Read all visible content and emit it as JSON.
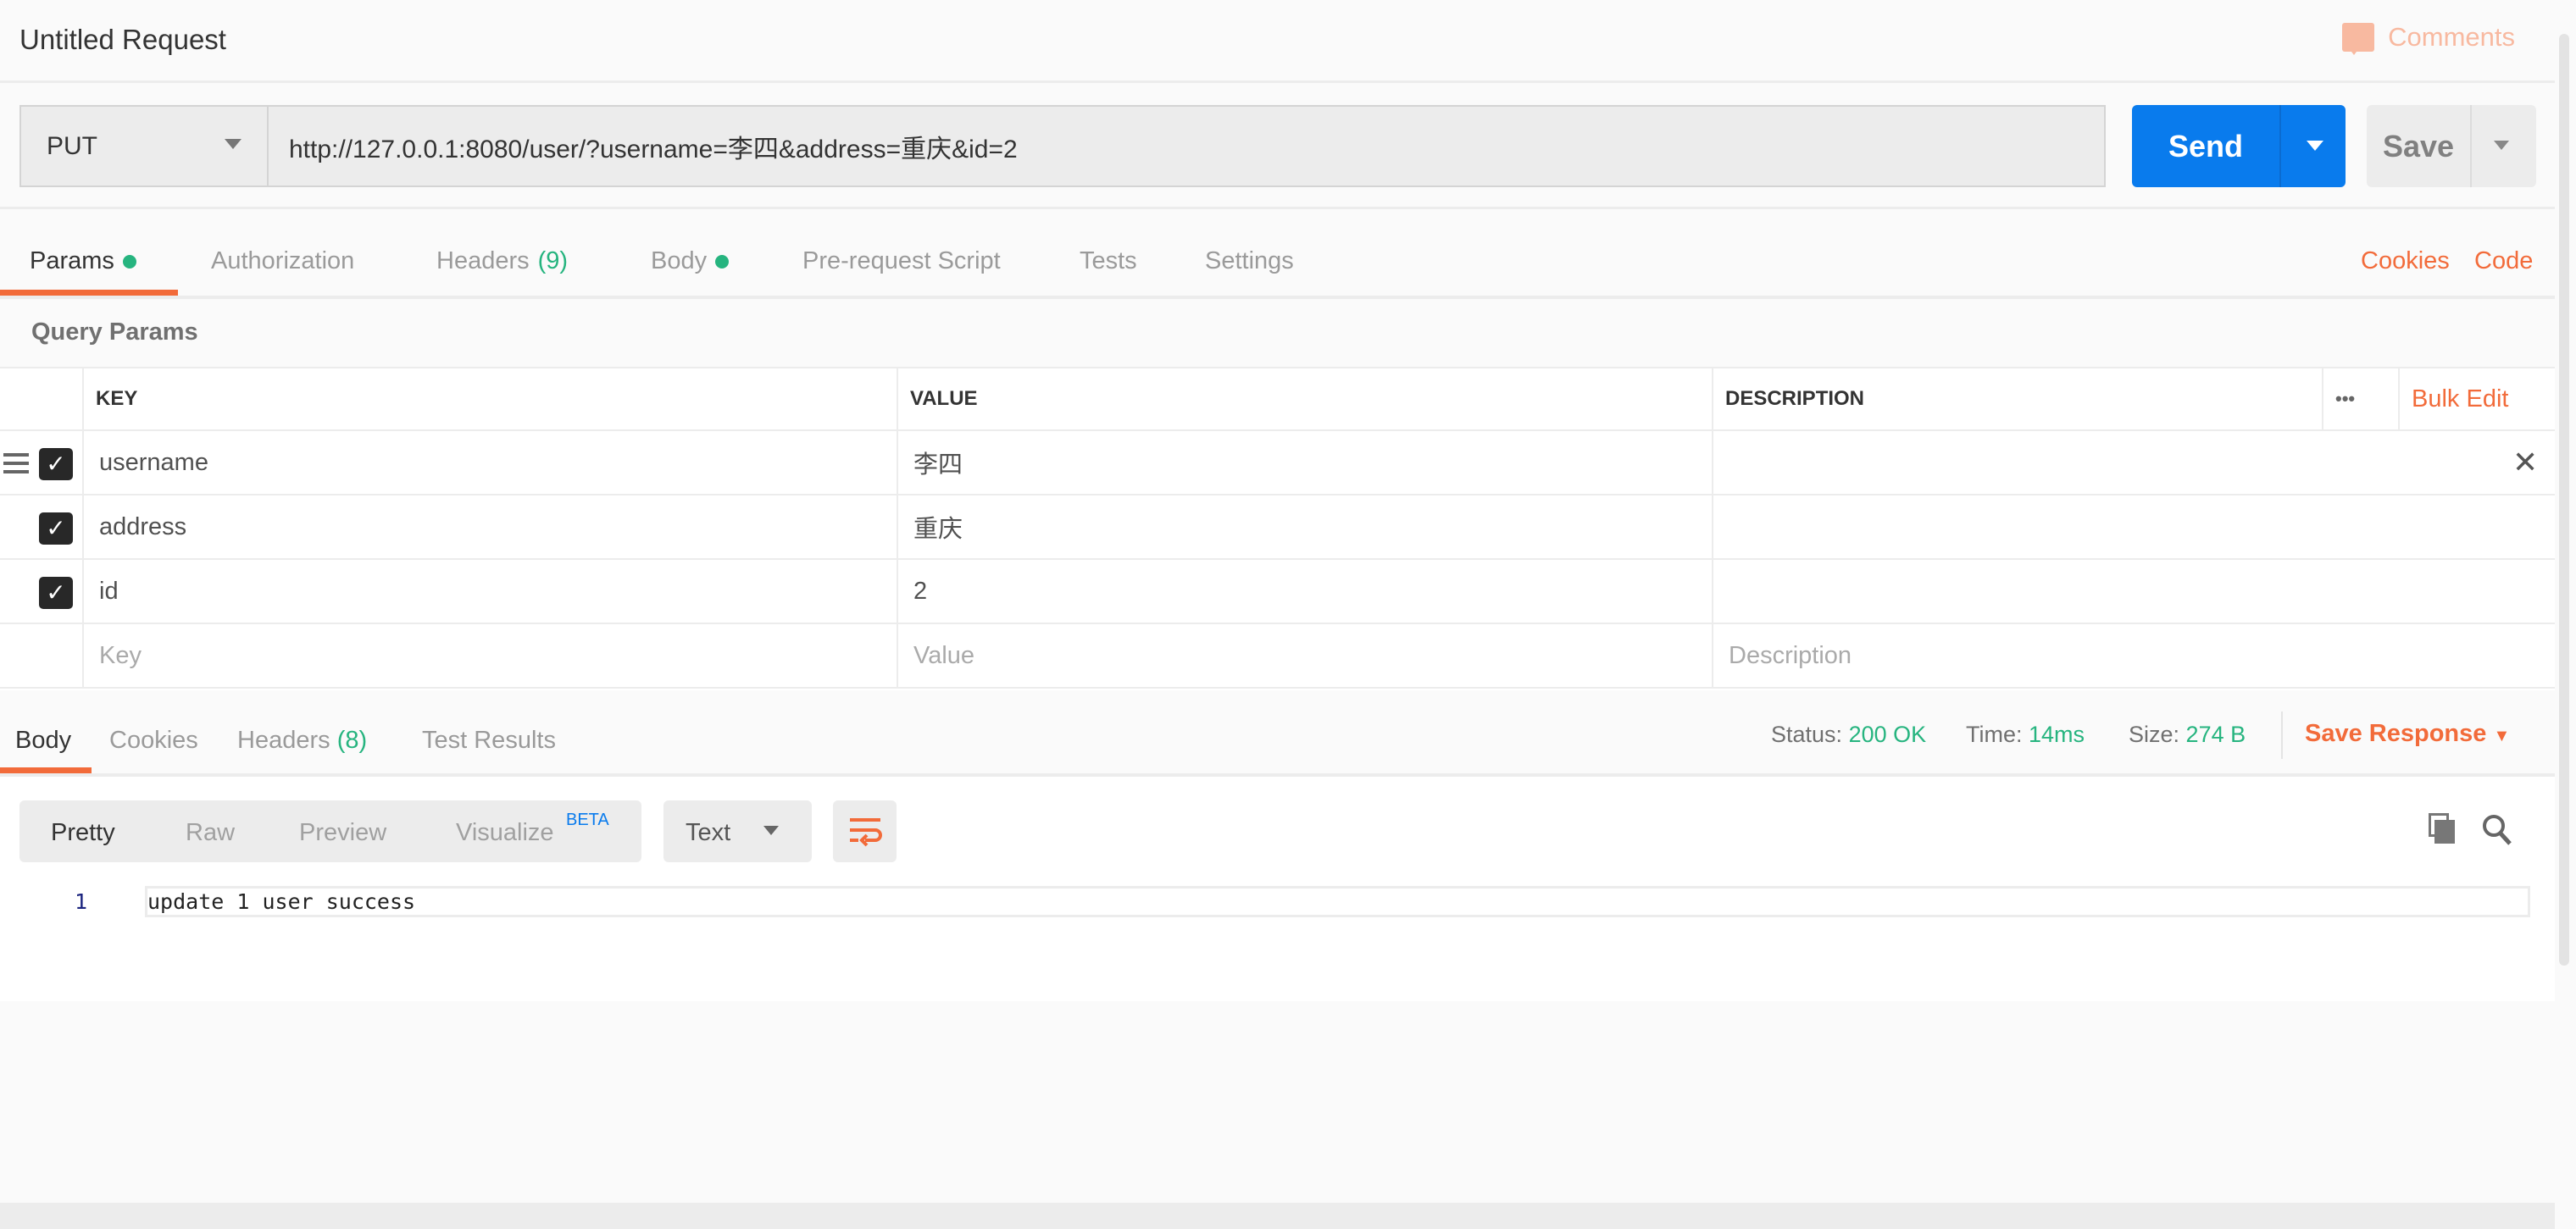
{
  "header": {
    "title": "Untitled Request",
    "comments_label": "Comments"
  },
  "request": {
    "method": "PUT",
    "url": "http://127.0.0.1:8080/user/?username=李四&address=重庆&id=2",
    "send_label": "Send",
    "save_label": "Save"
  },
  "tabs": [
    {
      "label": "Params",
      "dot": true,
      "active": true
    },
    {
      "label": "Authorization"
    },
    {
      "label": "Headers",
      "count": "(9)"
    },
    {
      "label": "Body",
      "dot": true
    },
    {
      "label": "Pre-request Script"
    },
    {
      "label": "Tests"
    },
    {
      "label": "Settings"
    }
  ],
  "right_links": {
    "cookies": "Cookies",
    "code": "Code"
  },
  "query_params": {
    "label": "Query Params",
    "headers": {
      "key": "KEY",
      "value": "VALUE",
      "description": "DESCRIPTION",
      "more": "•••",
      "bulk_edit": "Bulk Edit"
    },
    "rows": [
      {
        "key": "username",
        "value": "李四",
        "description": "",
        "checked": true
      },
      {
        "key": "address",
        "value": "重庆",
        "description": "",
        "checked": true
      },
      {
        "key": "id",
        "value": "2",
        "description": "",
        "checked": true
      }
    ],
    "placeholders": {
      "key": "Key",
      "value": "Value",
      "description": "Description"
    }
  },
  "response": {
    "tabs": [
      {
        "label": "Body",
        "active": true
      },
      {
        "label": "Cookies"
      },
      {
        "label": "Headers",
        "count": "(8)"
      },
      {
        "label": "Test Results"
      }
    ],
    "status_label": "Status:",
    "status": "200 OK",
    "time_label": "Time:",
    "time": "14ms",
    "size_label": "Size:",
    "size": "274 B",
    "save_response": "Save Response",
    "view_modes": [
      "Pretty",
      "Raw",
      "Preview",
      "Visualize"
    ],
    "beta": "BETA",
    "format": "Text",
    "lines": [
      {
        "number": "1",
        "text": "update 1 user success"
      }
    ]
  },
  "colors": {
    "accent": "#f26b3a",
    "send": "#097bed",
    "success": "#26b47f"
  }
}
